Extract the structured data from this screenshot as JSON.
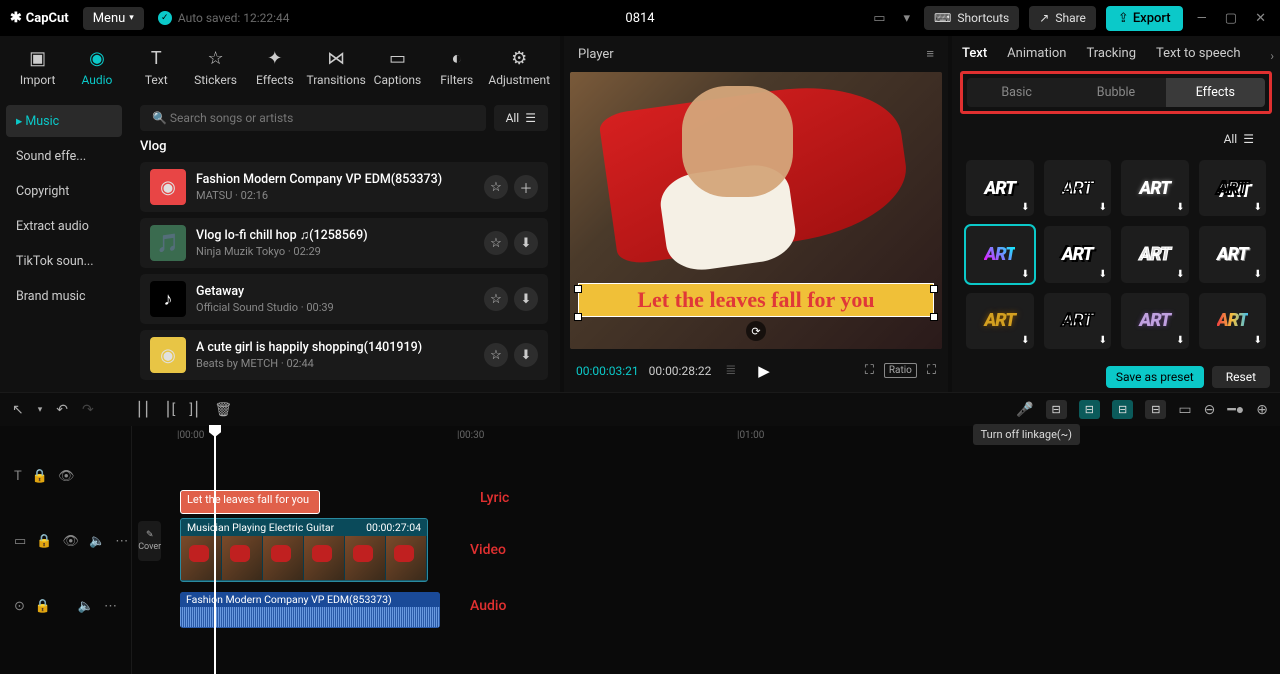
{
  "titlebar": {
    "logo": "CapCut",
    "menu": "Menu",
    "autosaved": "Auto saved: 12:22:44",
    "project": "0814",
    "shortcuts": "Shortcuts",
    "share": "Share",
    "export": "Export"
  },
  "tools": {
    "items": [
      "Import",
      "Audio",
      "Text",
      "Stickers",
      "Effects",
      "Transitions",
      "Captions",
      "Filters",
      "Adjustment"
    ],
    "active": 1
  },
  "audioSide": {
    "items": [
      "Music",
      "Sound effe...",
      "Copyright",
      "Extract audio",
      "TikTok soun...",
      "Brand music"
    ],
    "active": 0
  },
  "search": {
    "placeholder": "Search songs or artists",
    "all": "All"
  },
  "section": "Vlog",
  "tracks": [
    {
      "title": "Fashion Modern Company VP EDM(853373)",
      "artist": "MATSU",
      "dur": "02:16",
      "act": "add"
    },
    {
      "title": "Vlog lo-fi chill hop ♫(1258569)",
      "artist": "Ninja Muzik Tokyo",
      "dur": "02:29",
      "act": "dl"
    },
    {
      "title": "Getaway",
      "artist": "Official Sound Studio",
      "dur": "00:39",
      "act": "dl"
    },
    {
      "title": "A cute girl is happily shopping(1401919)",
      "artist": "Beats by METCH",
      "dur": "02:44",
      "act": "dl"
    }
  ],
  "player": {
    "title": "Player",
    "overlay": "Let the leaves fall for you",
    "current": "00:00:03:21",
    "duration": "00:00:28:22",
    "ratio": "Ratio"
  },
  "rightPanel": {
    "tabs": [
      "Text",
      "Animation",
      "Tracking",
      "Text to speech"
    ],
    "activeTab": 0,
    "subTabs": [
      "Basic",
      "Bubble",
      "Effects"
    ],
    "activeSub": 2,
    "all": "All",
    "cells": 12,
    "selected": 4,
    "savePreset": "Save as preset",
    "reset": "Reset"
  },
  "tooltip": "Turn off linkage(~)",
  "timeline": {
    "marks": [
      {
        "label": "|00:00",
        "pos": 45
      },
      {
        "label": "|00:30",
        "pos": 325
      },
      {
        "label": "|01:00",
        "pos": 605
      }
    ],
    "textClip": "Let the leaves fall for you",
    "videoClip": {
      "title": "Musician Playing Electric Guitar",
      "dur": "00:00:27:04"
    },
    "audioClip": "Fashion Modern Company VP EDM(853373)",
    "labels": {
      "lyric": "Lyric",
      "video": "Video",
      "audio": "Audio"
    },
    "cover": "Cover"
  }
}
